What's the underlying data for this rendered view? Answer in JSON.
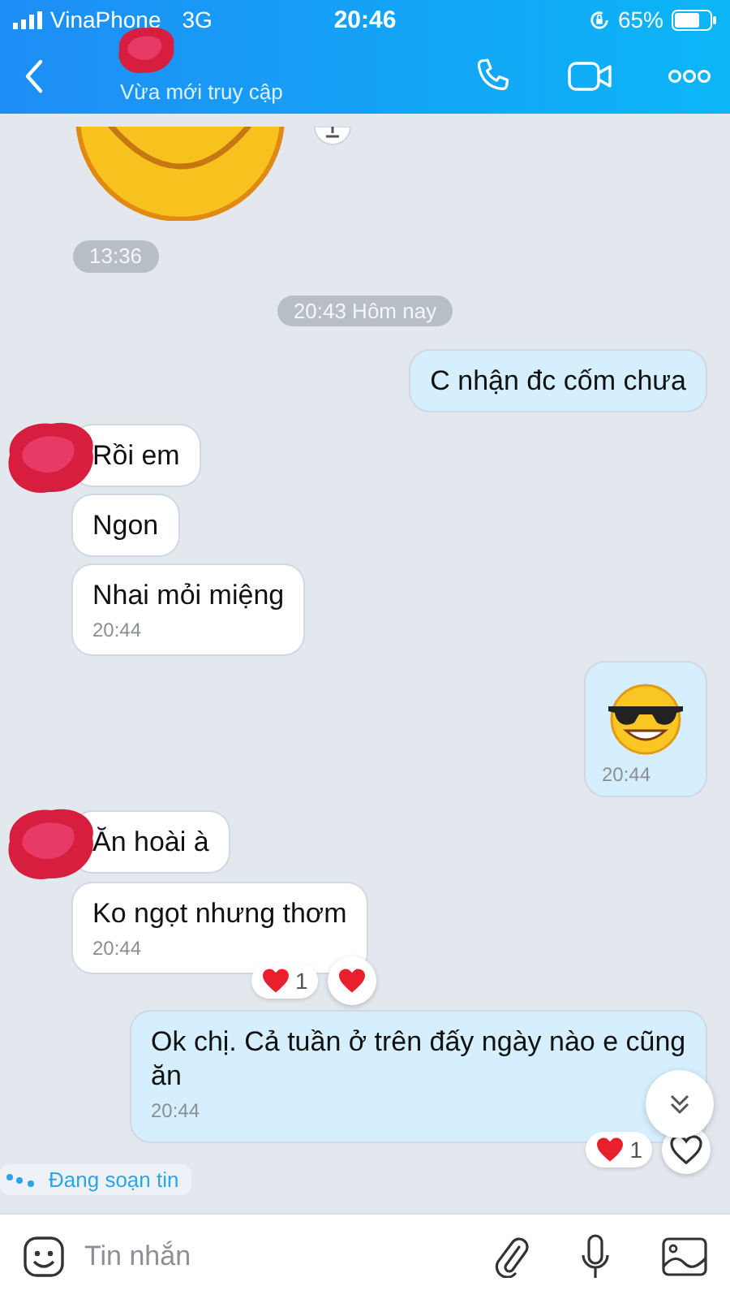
{
  "status_bar": {
    "carrier": "VinaPhone",
    "network": "3G",
    "time": "20:46",
    "battery": "65%"
  },
  "header": {
    "status": "Vừa mới truy cập"
  },
  "messages": [
    {
      "kind": "sticker",
      "outgoing": false,
      "time": "13:36"
    },
    {
      "kind": "date",
      "text": "20:43 Hôm nay"
    },
    {
      "kind": "text",
      "outgoing": true,
      "text": "C nhận đc cốm chưa"
    },
    {
      "kind": "text",
      "outgoing": false,
      "text": "Rồi em",
      "avatar": true
    },
    {
      "kind": "text",
      "outgoing": false,
      "text": "Ngon"
    },
    {
      "kind": "text",
      "outgoing": false,
      "text": "Nhai mỏi miệng",
      "time": "20:44"
    },
    {
      "kind": "emoji",
      "outgoing": true,
      "time": "20:44"
    },
    {
      "kind": "text",
      "outgoing": false,
      "text": "Ăn hoài à",
      "avatar": true
    },
    {
      "kind": "text",
      "outgoing": false,
      "text": "Ko ngọt nhưng thơm",
      "time": "20:44",
      "reaction_count": "1",
      "reacted": true
    },
    {
      "kind": "text",
      "outgoing": true,
      "text": "Ok chị. Cả tuần ở trên đấy ngày nào e cũng ăn",
      "time": "20:44",
      "reaction_count": "1",
      "reacted": false
    }
  ],
  "typing": "Đang soạn tin",
  "composer": {
    "placeholder": "Tin nhắn"
  }
}
